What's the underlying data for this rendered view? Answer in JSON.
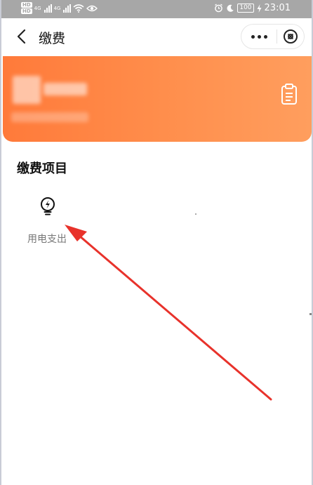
{
  "status_bar": {
    "left_badges": [
      "HD",
      "HD"
    ],
    "signal_labels": [
      "4G",
      "4G"
    ],
    "battery": "100",
    "time": "23:01",
    "icons": [
      "wifi-icon",
      "eye-icon",
      "alarm-icon",
      "moon-icon",
      "battery-icon",
      "charging-icon"
    ]
  },
  "nav": {
    "title": "缴费",
    "back_icon": "chevron-left-icon",
    "more_icon": "more-dots-icon",
    "close_icon": "close-circle-icon"
  },
  "banner": {
    "gradient": [
      "#ff7a3a",
      "#ff9e5e"
    ],
    "icon": "clipboard-icon"
  },
  "section": {
    "title": "缴费项目",
    "items": [
      {
        "label": "用电支出",
        "icon": "lightbulb-icon"
      }
    ]
  },
  "annotation": {
    "arrow_color": "#e8322b"
  }
}
